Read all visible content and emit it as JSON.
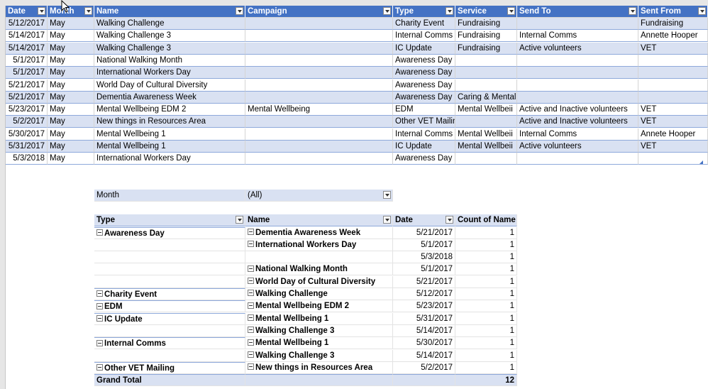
{
  "table": {
    "headers": [
      "Date",
      "Month",
      "Name",
      "Campaign",
      "Type",
      "Service",
      "Send To",
      "Sent From"
    ],
    "rows": [
      [
        "5/12/2017",
        "May",
        "Walking Challenge",
        "",
        "Charity Event",
        "Fundraising",
        "",
        "Fundraising"
      ],
      [
        "5/14/2017",
        "May",
        "Walking Challenge 3",
        "",
        "Internal Comms",
        "Fundraising",
        "Internal Comms",
        "Annette Hooper"
      ],
      [
        "5/14/2017",
        "May",
        "Walking Challenge 3",
        "",
        "IC Update",
        "Fundraising",
        "Active volunteers",
        "VET"
      ],
      [
        "5/1/2017",
        "May",
        "National Walking Month",
        "",
        "Awareness Day",
        "",
        "",
        ""
      ],
      [
        "5/1/2017",
        "May",
        "International Workers Day",
        "",
        "Awareness Day",
        "",
        "",
        ""
      ],
      [
        "5/21/2017",
        "May",
        "World Day of Cultural Diversity",
        "",
        "Awareness Day",
        "",
        "",
        ""
      ],
      [
        "5/21/2017",
        "May",
        "Dementia Awareness Week",
        "",
        "Awareness Day",
        "Caring & Mental Wellbeing",
        "",
        ""
      ],
      [
        "5/23/2017",
        "May",
        "Mental Wellbeing EDM 2",
        "Mental Wellbeing",
        "EDM",
        "Mental Wellbeii",
        "Active and Inactive volunteers",
        "VET"
      ],
      [
        "5/2/2017",
        "May",
        "New things in Resources Area",
        "",
        "Other VET Mailing",
        "",
        "Active and Inactive volunteers",
        "VET"
      ],
      [
        "5/30/2017",
        "May",
        "Mental Wellbeing 1",
        "",
        "Internal Comms",
        "Mental Wellbeii",
        "Internal Comms",
        "Annete Hooper"
      ],
      [
        "5/31/2017",
        "May",
        "Mental Wellbeing 1",
        "",
        "IC Update",
        "Mental Wellbeii",
        "Active volunteers",
        "VET"
      ],
      [
        "5/3/2018",
        "May",
        "International Workers Day",
        "",
        "Awareness Day",
        "",
        "",
        ""
      ]
    ]
  },
  "pivot": {
    "filter_label": "Month",
    "filter_value": "(All)",
    "headers": [
      "Type",
      "Name",
      "Date",
      "Count of Name"
    ],
    "rows": [
      {
        "type": "Awareness Day",
        "name": "Dementia Awareness Week",
        "date": "5/21/2017",
        "count": "1"
      },
      {
        "type": "",
        "name": "International Workers Day",
        "date": "5/1/2017",
        "count": "1"
      },
      {
        "type": "",
        "name": "",
        "date": "5/3/2018",
        "count": "1"
      },
      {
        "type": "",
        "name": "National Walking Month",
        "date": "5/1/2017",
        "count": "1"
      },
      {
        "type": "",
        "name": "World Day of Cultural Diversity",
        "date": "5/21/2017",
        "count": "1"
      },
      {
        "type": "Charity Event",
        "name": "Walking Challenge",
        "date": "5/12/2017",
        "count": "1"
      },
      {
        "type": "EDM",
        "name": "Mental Wellbeing EDM 2",
        "date": "5/23/2017",
        "count": "1"
      },
      {
        "type": "IC Update",
        "name": "Mental Wellbeing 1",
        "date": "5/31/2017",
        "count": "1"
      },
      {
        "type": "",
        "name": "Walking Challenge 3",
        "date": "5/14/2017",
        "count": "1"
      },
      {
        "type": "Internal Comms",
        "name": "Mental Wellbeing 1",
        "date": "5/30/2017",
        "count": "1"
      },
      {
        "type": "",
        "name": "Walking Challenge 3",
        "date": "5/14/2017",
        "count": "1"
      },
      {
        "type": "Other VET Mailing",
        "name": "New things in Resources Area",
        "date": "5/2/2017",
        "count": "1"
      }
    ],
    "grand_total_label": "Grand Total",
    "grand_total_value": "12"
  },
  "colors": {
    "header_blue": "#4472c4",
    "band_blue": "#d9e1f2",
    "border_blue": "#8ea9db"
  },
  "icons": [
    "filter-dropdown-icon",
    "collapse-minus-icon",
    "mouse-pointer-icon"
  ]
}
